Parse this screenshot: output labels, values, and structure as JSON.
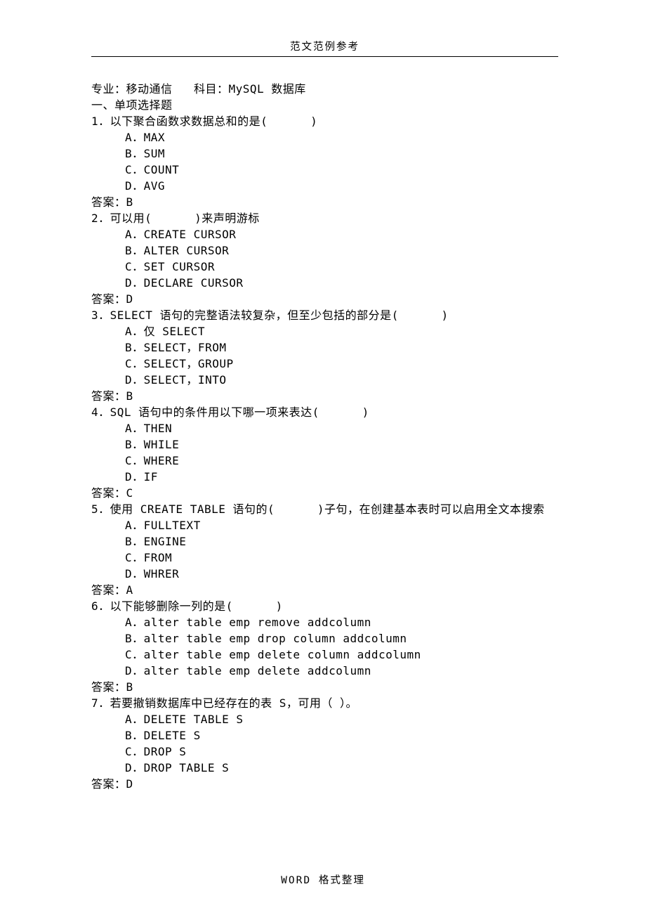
{
  "header": "范文范例参考",
  "footer": "WORD 格式整理",
  "intro": {
    "major_label": "专业：",
    "major": "移动通信",
    "subject_label": "科目：",
    "subject": "MySQL 数据库"
  },
  "section_title": "一、单项选择题",
  "answer_label": "答案：",
  "questions": [
    {
      "num": "1．",
      "stem": "以下聚合函数求数据总和的是(      )",
      "options": [
        {
          "label": "A．",
          "text": "MAX"
        },
        {
          "label": "B．",
          "text": "SUM"
        },
        {
          "label": "C．",
          "text": "COUNT"
        },
        {
          "label": "D．",
          "text": "AVG"
        }
      ],
      "answer": "B"
    },
    {
      "num": "2．",
      "stem": "可以用(      )来声明游标",
      "options": [
        {
          "label": "A．",
          "text": "CREATE CURSOR"
        },
        {
          "label": "B．",
          "text": "ALTER CURSOR"
        },
        {
          "label": "C．",
          "text": "SET CURSOR"
        },
        {
          "label": "D．",
          "text": "DECLARE CURSOR"
        }
      ],
      "answer": "D"
    },
    {
      "num": "3．",
      "stem": "SELECT 语句的完整语法较复杂，但至少包括的部分是(      )",
      "options": [
        {
          "label": "A．",
          "text": "仅 SELECT"
        },
        {
          "label": "B．",
          "text": "SELECT，FROM"
        },
        {
          "label": "C．",
          "text": "SELECT，GROUP"
        },
        {
          "label": "D．",
          "text": "SELECT，INTO"
        }
      ],
      "answer": "B"
    },
    {
      "num": "4．",
      "stem": "SQL 语句中的条件用以下哪一项来表达(      )",
      "options": [
        {
          "label": "A．",
          "text": "THEN"
        },
        {
          "label": "B．",
          "text": "WHILE"
        },
        {
          "label": "C．",
          "text": "WHERE"
        },
        {
          "label": "D．",
          "text": "IF"
        }
      ],
      "answer": "C"
    },
    {
      "num": "5．",
      "stem": "使用 CREATE TABLE 语句的(      )子句，在创建基本表时可以启用全文本搜索",
      "options": [
        {
          "label": "A．",
          "text": "FULLTEXT"
        },
        {
          "label": "B．",
          "text": "ENGINE"
        },
        {
          "label": "C．",
          "text": "FROM"
        },
        {
          "label": "D．",
          "text": "WHRER"
        }
      ],
      "answer": "A"
    },
    {
      "num": "6．",
      "stem": "以下能够删除一列的是(      )",
      "options": [
        {
          "label": "A．",
          "text": "alter table emp remove addcolumn"
        },
        {
          "label": "B．",
          "text": "alter table emp drop column addcolumn"
        },
        {
          "label": "C．",
          "text": "alter table emp delete column addcolumn"
        },
        {
          "label": "D．",
          "text": "alter table emp delete addcolumn"
        }
      ],
      "answer": "B"
    },
    {
      "num": "7．",
      "stem": "若要撤销数据库中已经存在的表 S，可用（ ）。",
      "options": [
        {
          "label": "A．",
          "text": "DELETE TABLE S"
        },
        {
          "label": "B．",
          "text": "DELETE S"
        },
        {
          "label": "C．",
          "text": "DROP S"
        },
        {
          "label": "D．",
          "text": "DROP TABLE S"
        }
      ],
      "answer": "D"
    }
  ]
}
